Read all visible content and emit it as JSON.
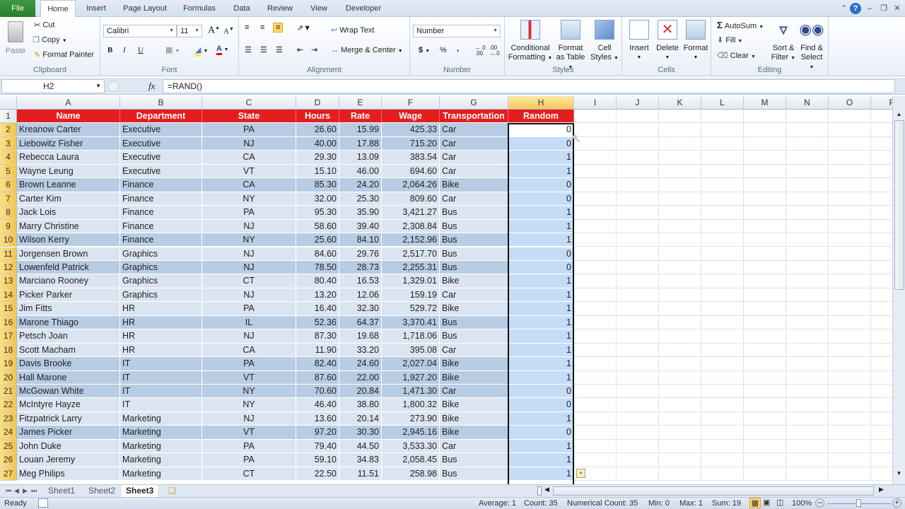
{
  "ribbon_tabs": [
    "File",
    "Home",
    "Insert",
    "Page Layout",
    "Formulas",
    "Data",
    "Review",
    "View",
    "Developer"
  ],
  "active_tab": "Home",
  "clipboard": {
    "paste": "Paste",
    "cut": "Cut",
    "copy": "Copy",
    "format_painter": "Format Painter",
    "label": "Clipboard"
  },
  "font": {
    "name": "Calibri",
    "size": "11",
    "bold": "B",
    "italic": "I",
    "underline": "U",
    "label": "Font"
  },
  "alignment": {
    "wrap_text": "Wrap Text",
    "merge_center": "Merge & Center",
    "label": "Alignment"
  },
  "number": {
    "format": "Number",
    "currency": "$",
    "percent": "%",
    "comma": ",",
    "inc_decimal": "+.0 .00",
    "dec_decimal": ".00 +.0",
    "label": "Number"
  },
  "styles": {
    "conditional": [
      "Conditional",
      "Formatting"
    ],
    "format_table": [
      "Format",
      "as Table"
    ],
    "cell_styles": [
      "Cell",
      "Styles"
    ],
    "label": "Styles"
  },
  "cells": {
    "insert": "Insert",
    "delete": "Delete",
    "format": "Format",
    "label": "Cells"
  },
  "editing": {
    "autosum": "AutoSum",
    "fill": "Fill",
    "clear": "Clear",
    "sort_filter": [
      "Sort &",
      "Filter"
    ],
    "find_select": [
      "Find &",
      "Select"
    ],
    "label": "Editing"
  },
  "formula_bar": {
    "name_box": "H2",
    "fx": "fx",
    "formula": "=RAND()"
  },
  "columns": [
    "A",
    "B",
    "C",
    "D",
    "E",
    "F",
    "G",
    "H",
    "I",
    "J",
    "K",
    "L",
    "M",
    "N",
    "O",
    "P"
  ],
  "selected_column": "H",
  "table": {
    "headers": [
      "Name",
      "Department",
      "State",
      "Hours",
      "Rate",
      "Wage",
      "Transportation",
      "Random"
    ],
    "rows": [
      [
        "Kreanow Carter",
        "Executive",
        "PA",
        "26.60",
        "15.99",
        "425.33",
        "Car",
        "0"
      ],
      [
        "Liebowitz Fisher",
        "Executive",
        "NJ",
        "40.00",
        "17.88",
        "715.20",
        "Car",
        "0"
      ],
      [
        "Rebecca Laura",
        "Executive",
        "CA",
        "29.30",
        "13.09",
        "383.54",
        "Car",
        "1"
      ],
      [
        "Wayne Leung",
        "Executive",
        "VT",
        "15.10",
        "46.00",
        "694.60",
        "Car",
        "1"
      ],
      [
        "Brown Leanne",
        "Finance",
        "CA",
        "85.30",
        "24.20",
        "2,064.26",
        "Bike",
        "0"
      ],
      [
        "Carter Kim",
        "Finance",
        "NY",
        "32.00",
        "25.30",
        "809.60",
        "Car",
        "0"
      ],
      [
        "Jack Lois",
        "Finance",
        "PA",
        "95.30",
        "35.90",
        "3,421.27",
        "Bus",
        "1"
      ],
      [
        "Marry Christine",
        "Finance",
        "NJ",
        "58.60",
        "39.40",
        "2,308.84",
        "Bus",
        "1"
      ],
      [
        "Wilson Kerry",
        "Finance",
        "NY",
        "25.60",
        "84.10",
        "2,152.96",
        "Bus",
        "1"
      ],
      [
        "Jorgensen Brown",
        "Graphics",
        "NJ",
        "84.60",
        "29.76",
        "2,517.70",
        "Bus",
        "0"
      ],
      [
        "Lowenfeld Patrick",
        "Graphics",
        "NJ",
        "78.50",
        "28.73",
        "2,255.31",
        "Bus",
        "0"
      ],
      [
        "Marciano Rooney",
        "Graphics",
        "CT",
        "80.40",
        "16.53",
        "1,329.01",
        "Bike",
        "1"
      ],
      [
        "Picker Parker",
        "Graphics",
        "NJ",
        "13.20",
        "12.06",
        "159.19",
        "Car",
        "1"
      ],
      [
        "Jim Fitts",
        "HR",
        "PA",
        "16.40",
        "32.30",
        "529.72",
        "Bike",
        "1"
      ],
      [
        "Marone Thiago",
        "HR",
        "IL",
        "52.36",
        "64.37",
        "3,370.41",
        "Bus",
        "1"
      ],
      [
        "Petsch Joan",
        "HR",
        "NJ",
        "87.30",
        "19.68",
        "1,718.06",
        "Bus",
        "1"
      ],
      [
        "Scott Macham",
        "HR",
        "CA",
        "11.90",
        "33.20",
        "395.08",
        "Car",
        "1"
      ],
      [
        "Davis Brooke",
        "IT",
        "PA",
        "82.40",
        "24.60",
        "2,027.04",
        "Bike",
        "1"
      ],
      [
        "Hall Marone",
        "IT",
        "VT",
        "87.60",
        "22.00",
        "1,927.20",
        "Bike",
        "1"
      ],
      [
        "McGowan White",
        "IT",
        "NY",
        "70.60",
        "20.84",
        "1,471.30",
        "Car",
        "0"
      ],
      [
        "McIntyre Hayze",
        "IT",
        "NY",
        "46.40",
        "38.80",
        "1,800.32",
        "Bike",
        "0"
      ],
      [
        "Fitzpatrick Larry",
        "Marketing",
        "NJ",
        "13.60",
        "20.14",
        "273.90",
        "Bike",
        "1"
      ],
      [
        "James Picker",
        "Marketing",
        "VT",
        "97.20",
        "30.30",
        "2,945.16",
        "Bike",
        "0"
      ],
      [
        "John Duke",
        "Marketing",
        "PA",
        "79.40",
        "44.50",
        "3,533.30",
        "Car",
        "1"
      ],
      [
        "Louan Jeremy",
        "Marketing",
        "PA",
        "59.10",
        "34.83",
        "2,058.45",
        "Bus",
        "1"
      ],
      [
        "Meg Philips",
        "Marketing",
        "CT",
        "22.50",
        "11.51",
        "258.98",
        "Bus",
        "1"
      ]
    ]
  },
  "sheets": [
    "Sheet1",
    "Sheet2",
    "Sheet3"
  ],
  "active_sheet": "Sheet3",
  "status": {
    "mode": "Ready",
    "average": "Average: 1",
    "count": "Count: 35",
    "numerical_count": "Numerical Count: 35",
    "min": "Min: 0",
    "max": "Max: 1",
    "sum": "Sum: 19",
    "zoom": "100%"
  },
  "colors": {
    "header_red": "#e41e1e",
    "band_dark": "#b8cce4",
    "band_light": "#dbe5f1",
    "selection": "#c5dcf6",
    "file_tab": "#2f8a33"
  }
}
